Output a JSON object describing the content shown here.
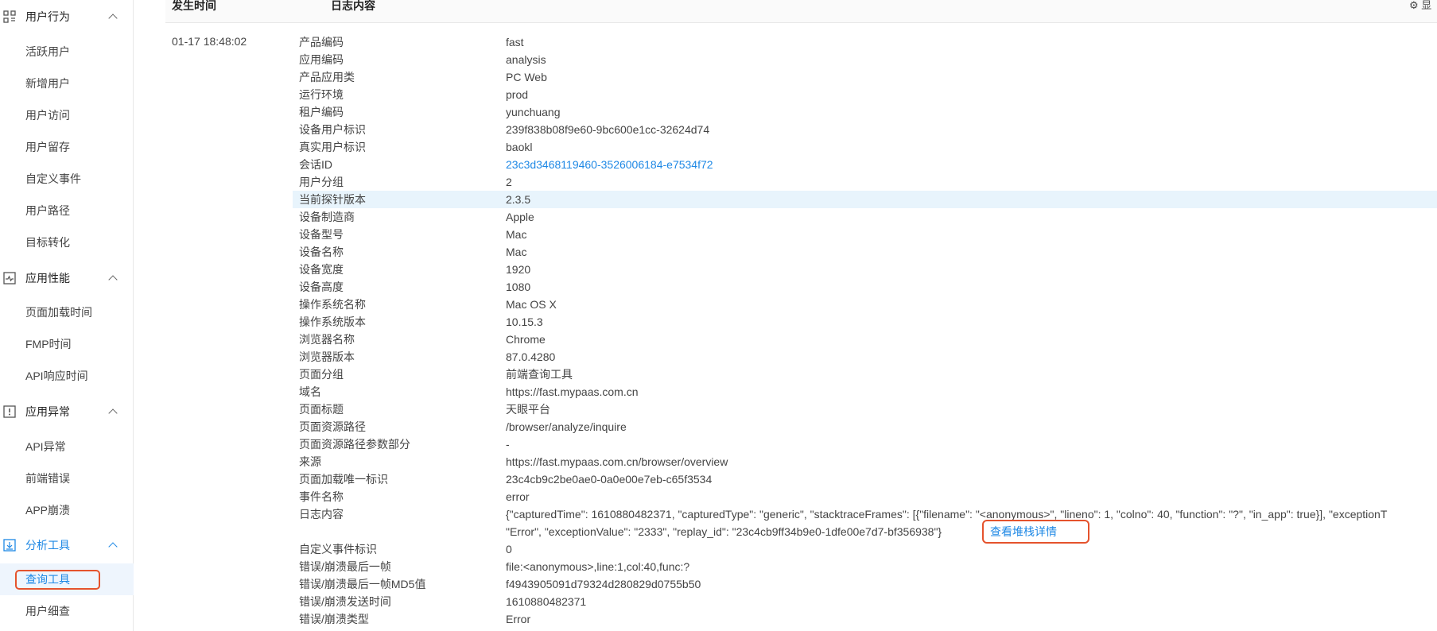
{
  "sidebar": {
    "groups": [
      {
        "label": "用户行为",
        "icon": "grid-icon",
        "items": [
          "活跃用户",
          "新增用户",
          "用户访问",
          "用户留存",
          "自定义事件",
          "用户路径",
          "目标转化"
        ]
      },
      {
        "label": "应用性能",
        "icon": "pulse-chart-icon",
        "items": [
          "页面加载时间",
          "FMP时间",
          "API响应时间"
        ]
      },
      {
        "label": "应用异常",
        "icon": "alert-box-icon",
        "items": [
          "API异常",
          "前端错误",
          "APP崩溃"
        ]
      },
      {
        "label": "分析工具",
        "icon": "download-box-icon",
        "items": [
          "查询工具",
          "用户细查"
        ]
      }
    ]
  },
  "table": {
    "col_time": "发生时间",
    "col_content": "日志内容",
    "settings_label": "显",
    "time": "01-17 18:48:02"
  },
  "log_rows": [
    {
      "k": "产品编码",
      "v": "fast"
    },
    {
      "k": "应用编码",
      "v": "analysis"
    },
    {
      "k": "产品应用类",
      "v": "PC Web"
    },
    {
      "k": "运行环境",
      "v": "prod"
    },
    {
      "k": "租户编码",
      "v": "yunchuang"
    },
    {
      "k": "设备用户标识",
      "v": "239f838b08f9e60-9bc600e1cc-32624d74"
    },
    {
      "k": "真实用户标识",
      "v": "baokl"
    },
    {
      "k": "会话ID",
      "v": "23c3d3468119460-3526006184-e7534f72"
    },
    {
      "k": "用户分组",
      "v": "2"
    },
    {
      "k": "当前探针版本",
      "v": "2.3.5"
    },
    {
      "k": "设备制造商",
      "v": "Apple"
    },
    {
      "k": "设备型号",
      "v": "Mac"
    },
    {
      "k": "设备名称",
      "v": "Mac"
    },
    {
      "k": "设备宽度",
      "v": "1920"
    },
    {
      "k": "设备高度",
      "v": "1080"
    },
    {
      "k": "操作系统名称",
      "v": "Mac OS X"
    },
    {
      "k": "操作系统版本",
      "v": "10.15.3"
    },
    {
      "k": "浏览器名称",
      "v": "Chrome"
    },
    {
      "k": "浏览器版本",
      "v": "87.0.4280"
    },
    {
      "k": "页面分组",
      "v": "前端查询工具"
    },
    {
      "k": "域名",
      "v": "https://fast.mypaas.com.cn"
    },
    {
      "k": "页面标题",
      "v": "天眼平台"
    },
    {
      "k": "页面资源路径",
      "v": "/browser/analyze/inquire"
    },
    {
      "k": "页面资源路径参数部分",
      "v": "-"
    },
    {
      "k": "来源",
      "v": "https://fast.mypaas.com.cn/browser/overview"
    },
    {
      "k": "页面加载唯一标识",
      "v": "23c4cb9c2be0ae0-0a0e00e7eb-c65f3534"
    },
    {
      "k": "事件名称",
      "v": "error"
    },
    {
      "k": "日志内容",
      "v": ""
    },
    {
      "k": "",
      "v": ""
    },
    {
      "k": "自定义事件标识",
      "v": "0"
    },
    {
      "k": "错误/崩溃最后一帧",
      "v": "file:<anonymous>,line:1,col:40,func:?"
    },
    {
      "k": "错误/崩溃最后一帧MD5值",
      "v": "f4943905091d79324d280829d0755b50"
    },
    {
      "k": "错误/崩溃发送时间",
      "v": "1610880482371"
    },
    {
      "k": "错误/崩溃类型",
      "v": "Error"
    }
  ],
  "log_content": {
    "line1": "{\"capturedTime\": 1610880482371, \"capturedType\": \"generic\", \"stacktraceFrames\": [{\"filename\": \"<anonymous>\", \"lineno\": 1, \"colno\": 40, \"function\": \"?\", \"in_app\": true}], \"exceptionT",
    "line2": "\"Error\", \"exceptionValue\": \"2333\", \"replay_id\": \"23c4cb9ff34b9e0-1dfe00e7d7-bf356938\"}",
    "stack_link": "查看堆栈详情"
  },
  "colors": {
    "accent": "#1e88e5",
    "highlight_row": "#e8f4fc",
    "callout": "#e5532d"
  }
}
